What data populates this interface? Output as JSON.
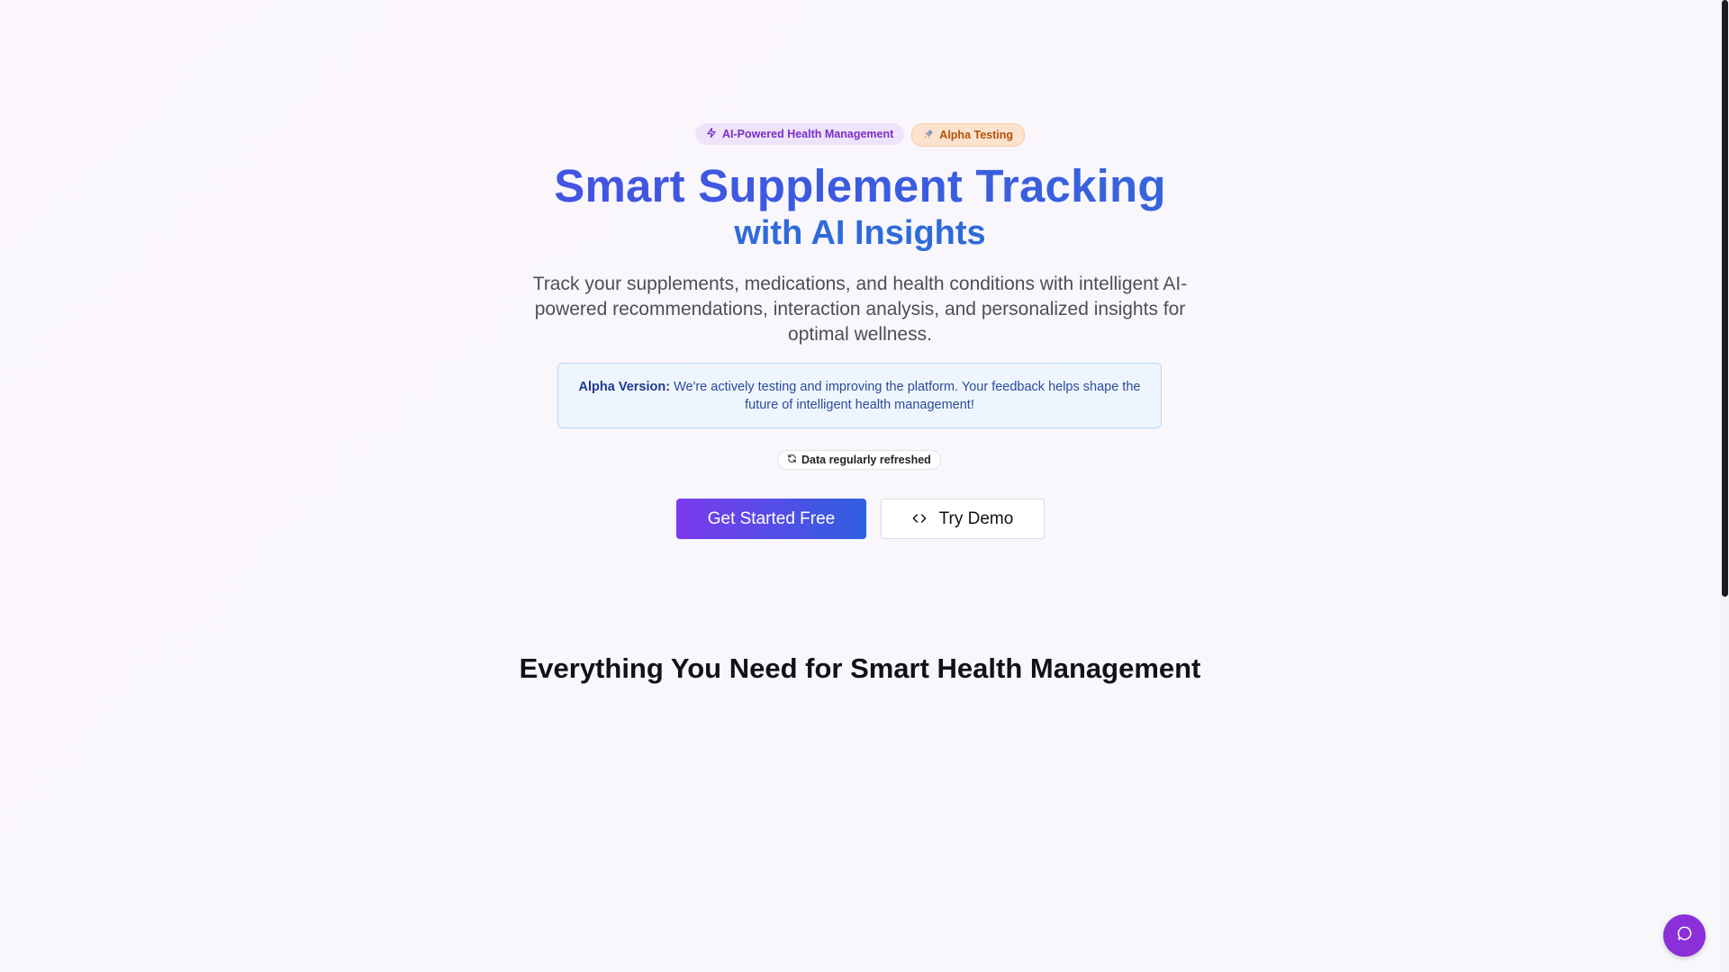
{
  "hero": {
    "badges": [
      {
        "label": "AI-Powered Health Management",
        "icon": "lightning-icon",
        "color": "#7a2fc7"
      },
      {
        "label": "Alpha Testing",
        "icon": "rocket-icon",
        "color": "#b1500e"
      }
    ],
    "headline": "Smart Supplement Tracking",
    "subheadline": "with AI Insights",
    "description": "Track your supplements, medications, and health conditions with intelligent AI-powered recommendations, interaction analysis, and personalized insights for optimal wellness.",
    "alpha_notice": {
      "label": "Alpha Version:",
      "text": "We're actively testing and improving the platform. Your feedback helps shape the future of intelligent health management!"
    },
    "refresh_status": {
      "label": "Data regularly refreshed",
      "icon": "refresh-icon"
    },
    "cta": {
      "primary_label": "Get Started Free",
      "secondary_label": "Try Demo",
      "secondary_icon": "code-icon"
    }
  },
  "features": {
    "title": "Everything You Need for Smart Health Management"
  },
  "chat": {
    "icon": "chat-bubble-icon",
    "color": "#8b2fd9"
  },
  "colors": {
    "brand_purple": "#7c3aed",
    "brand_blue": "#2f5fe0",
    "headline_blue": "#2f6bd8"
  }
}
